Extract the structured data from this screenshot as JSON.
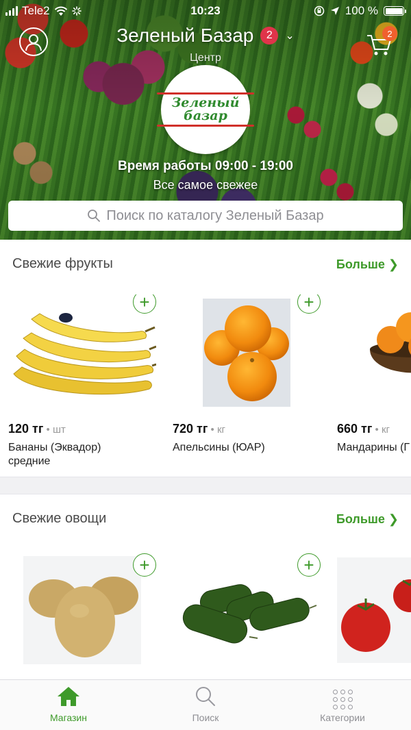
{
  "status_bar": {
    "carrier": "Tele2",
    "time": "10:23",
    "battery": "100 %"
  },
  "header": {
    "store_name": "Зеленый Базар",
    "store_badge": "2",
    "location": "Центр",
    "cart_count": "2",
    "logo_text": "Зеленый базар",
    "hours": "Время работы 09:00 - 19:00",
    "tagline": "Все самое свежее",
    "search_placeholder": "Поиск по каталогу Зеленый Базар"
  },
  "sections": {
    "fruits": {
      "title": "Свежие фрукты",
      "more": "Больше ❯",
      "products": [
        {
          "price": "120 тг",
          "unit": " • шт",
          "name": "Бананы (Эквадор) средние"
        },
        {
          "price": "720 тг",
          "unit": " • кг",
          "name": "Апельсины (ЮАР)"
        },
        {
          "price": "660 тг",
          "unit": " • кг",
          "name": "Мандарины (Г"
        }
      ]
    },
    "vegetables": {
      "title": "Свежие овощи",
      "more": "Больше ❯"
    }
  },
  "tabs": {
    "shop": "Магазин",
    "search": "Поиск",
    "categories": "Категории"
  },
  "colors": {
    "accent": "#3e9a2a",
    "badge": "#e0344a",
    "cart_badge": "#f0602e"
  }
}
